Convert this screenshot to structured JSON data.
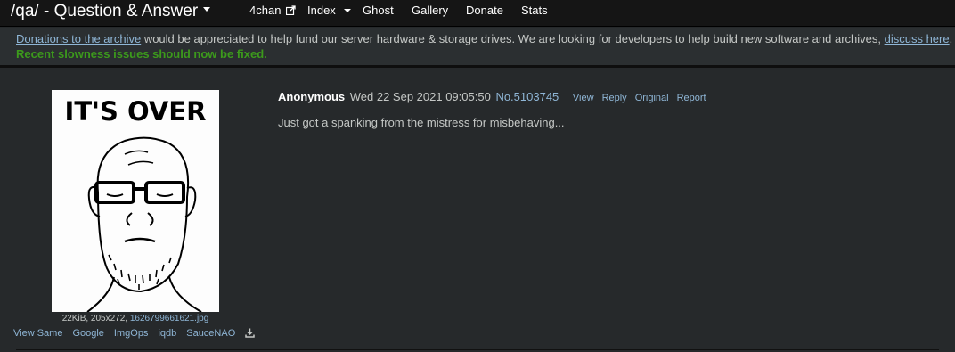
{
  "navbar": {
    "title": "/qa/ - Question & Answer",
    "links": [
      "4chan",
      "Index",
      "Ghost",
      "Gallery",
      "Donate",
      "Stats"
    ],
    "icons": [
      "external-link-icon",
      "chevron-down-icon"
    ]
  },
  "notice": {
    "donations_link": "Donations to the archive",
    "text_middle": " would be appreciated to help fund our server hardware & storage drives. We are looking for developers to help build new software and archives, ",
    "discuss_link": "discuss here",
    "text_end": ".",
    "fixed_text": "Recent slowness issues should now be fixed."
  },
  "post": {
    "image": {
      "caption_text": "IT'S OVER",
      "size": "22KiB, 205x272, ",
      "filename": "1626799661621.jpg"
    },
    "search_links": [
      "View Same",
      "Google",
      "ImgOps",
      "iqdb",
      "SauceNAO"
    ],
    "author": "Anonymous",
    "date": "Wed 22 Sep 2021 09:05:50",
    "number": "No.5103745",
    "actions": [
      "View",
      "Reply",
      "Original",
      "Report"
    ],
    "text": "Just got a spanking from the mistress for misbehaving..."
  },
  "colors": {
    "background": "#26292b",
    "navbar": "#151515",
    "link": "#8fb6d6",
    "fixed_notice": "#3c9a1c"
  }
}
